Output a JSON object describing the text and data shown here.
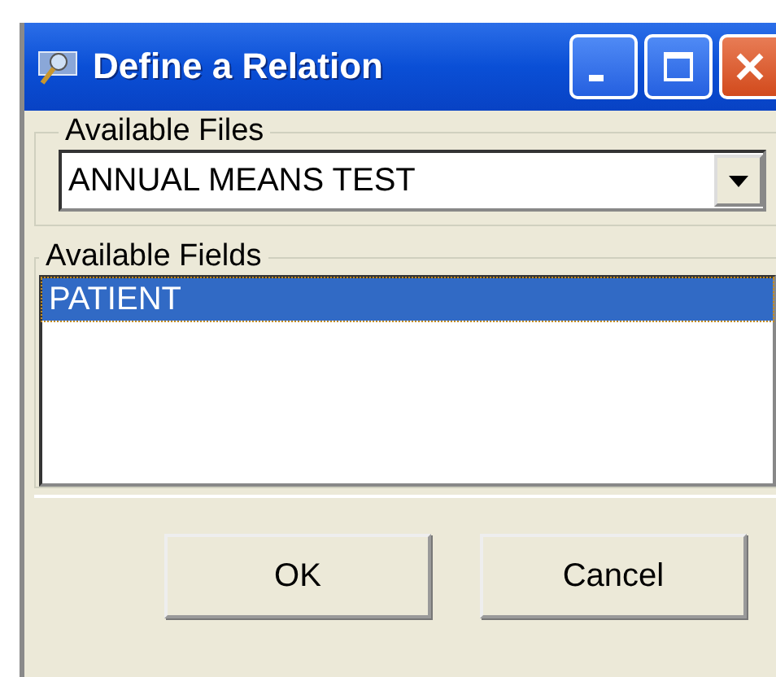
{
  "window": {
    "title": "Define a Relation"
  },
  "files_group": {
    "label": "Available Files",
    "selected_file": "ANNUAL MEANS TEST"
  },
  "fields_group": {
    "label": "Available Fields",
    "items": [
      {
        "label": "PATIENT",
        "selected": true
      }
    ]
  },
  "buttons": [
    "OK",
    "Cancel"
  ]
}
